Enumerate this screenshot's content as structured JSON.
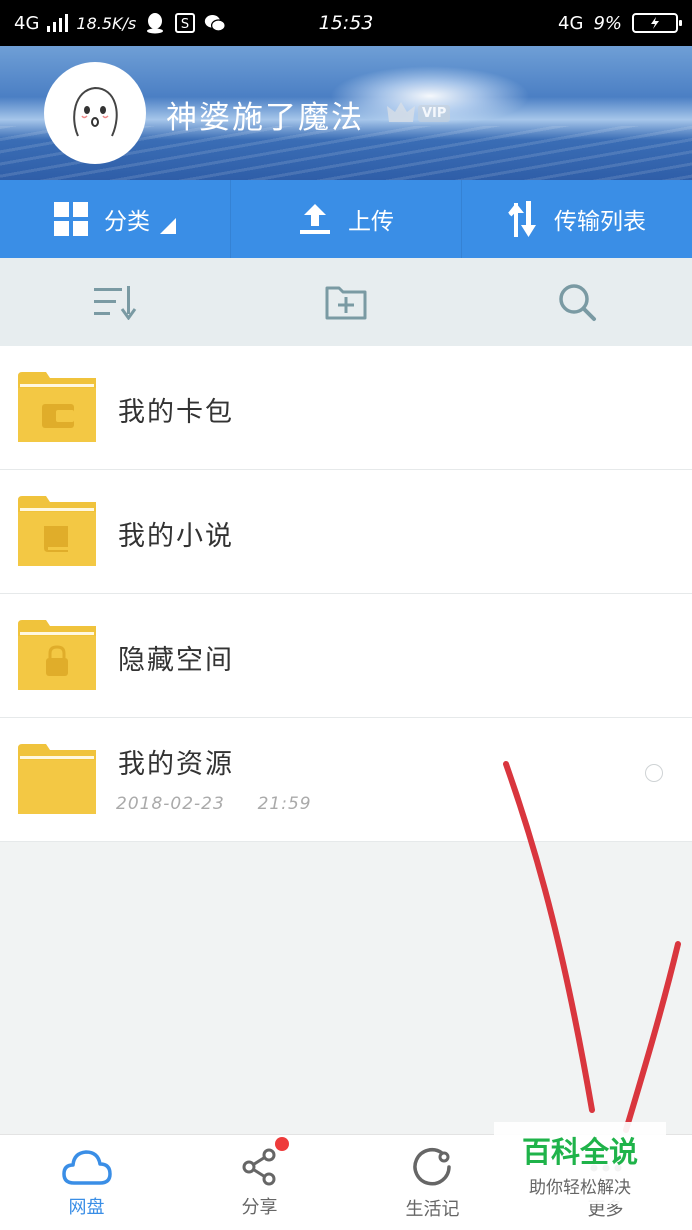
{
  "status_bar": {
    "network": "4G",
    "speed": "18.5K/s",
    "time": "15:53",
    "network_right": "4G",
    "battery": "9%"
  },
  "profile": {
    "username": "神婆施了魔法",
    "vip_label": "VIP"
  },
  "actions": [
    {
      "label": "分类",
      "icon": "grid-icon"
    },
    {
      "label": "上传",
      "icon": "upload-icon"
    },
    {
      "label": "传输列表",
      "icon": "transfer-icon"
    }
  ],
  "toolbar": {
    "icons": [
      "sort-icon",
      "new-folder-icon",
      "search-icon"
    ]
  },
  "files": [
    {
      "name": "我的卡包",
      "icon": "wallet-folder-icon"
    },
    {
      "name": "我的小说",
      "icon": "book-folder-icon"
    },
    {
      "name": "隐藏空间",
      "icon": "lock-folder-icon"
    },
    {
      "name": "我的资源",
      "date": "2018-02-23",
      "time": "21:59",
      "icon": "folder-icon"
    }
  ],
  "bottom_nav": [
    {
      "label": "网盘",
      "icon": "cloud-icon",
      "active": true
    },
    {
      "label": "分享",
      "icon": "share-icon",
      "badge": true
    },
    {
      "label": "生活记",
      "icon": "refresh-circle-icon"
    },
    {
      "label": "更多",
      "icon": "more-icon"
    }
  ],
  "watermark": {
    "title": "百科全说",
    "subtitle": "助你轻松解决"
  },
  "colors": {
    "accent": "#3a8ee6",
    "folder": "#f0c33c",
    "annotation": "#d9363e",
    "watermark": "#1fb34a"
  }
}
